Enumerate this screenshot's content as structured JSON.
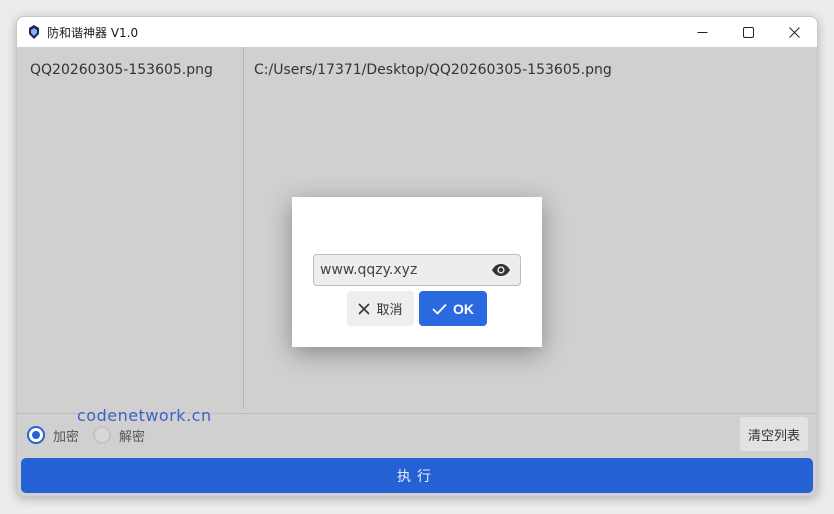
{
  "window": {
    "title": "防和谐神器 V1.0",
    "controls": {
      "minimize": "minimize-icon",
      "maximize": "maximize-icon",
      "close": "close-icon"
    }
  },
  "file_list": {
    "selected_name": "QQ20260305-153605.png",
    "selected_path": "C:/Users/17371/Desktop/QQ20260305-153605.png"
  },
  "watermark": "codenetwork.cn",
  "mode": {
    "options": [
      {
        "label": "加密",
        "checked": true
      },
      {
        "label": "解密",
        "checked": false
      }
    ]
  },
  "buttons": {
    "clear_list": "清空列表",
    "execute": "执行"
  },
  "dialog": {
    "password_value": "www.qqzy.xyz",
    "cancel_label": "取消",
    "ok_label": "OK"
  },
  "colors": {
    "accent": "#2361d4",
    "ok_button": "#2a69e0",
    "panel_bg": "#d0d0d0",
    "watermark": "#3b62c6"
  }
}
